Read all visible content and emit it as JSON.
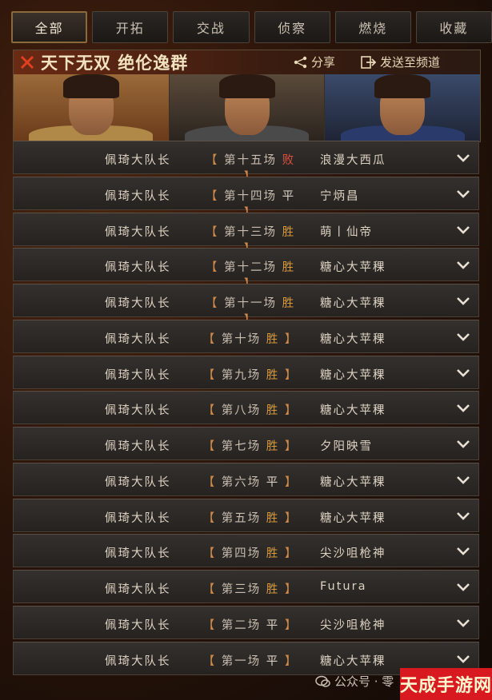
{
  "tabs": [
    {
      "label": "全部",
      "active": true
    },
    {
      "label": "开拓",
      "active": false
    },
    {
      "label": "交战",
      "active": false
    },
    {
      "label": "侦察",
      "active": false
    },
    {
      "label": "燃烧",
      "active": false
    },
    {
      "label": "收藏",
      "active": false
    }
  ],
  "banner": {
    "title": "天下无双 绝伦逸群",
    "share_label": "分享",
    "send_label": "发送至频道"
  },
  "rows": [
    {
      "player": "佩琦大队长",
      "match": "第十五场",
      "result": "败",
      "result_type": "lose",
      "opponent": "浪漫大西瓜"
    },
    {
      "player": "佩琦大队长",
      "match": "第十四场",
      "result": "平",
      "result_type": "draw",
      "opponent": "宁炳昌"
    },
    {
      "player": "佩琦大队长",
      "match": "第十三场",
      "result": "胜",
      "result_type": "win",
      "opponent": "萌丨仙帝"
    },
    {
      "player": "佩琦大队长",
      "match": "第十二场",
      "result": "胜",
      "result_type": "win",
      "opponent": "糖心大苹稞"
    },
    {
      "player": "佩琦大队长",
      "match": "第十一场",
      "result": "胜",
      "result_type": "win",
      "opponent": "糖心大苹稞"
    },
    {
      "player": "佩琦大队长",
      "match": "第十场",
      "result": "胜",
      "result_type": "win",
      "opponent": "糖心大苹稞"
    },
    {
      "player": "佩琦大队长",
      "match": "第九场",
      "result": "胜",
      "result_type": "win",
      "opponent": "糖心大苹稞"
    },
    {
      "player": "佩琦大队长",
      "match": "第八场",
      "result": "胜",
      "result_type": "win",
      "opponent": "糖心大苹稞"
    },
    {
      "player": "佩琦大队长",
      "match": "第七场",
      "result": "胜",
      "result_type": "win",
      "opponent": "夕阳映雪"
    },
    {
      "player": "佩琦大队长",
      "match": "第六场",
      "result": "平",
      "result_type": "draw",
      "opponent": "糖心大苹稞"
    },
    {
      "player": "佩琦大队长",
      "match": "第五场",
      "result": "胜",
      "result_type": "win",
      "opponent": "糖心大苹稞"
    },
    {
      "player": "佩琦大队长",
      "match": "第四场",
      "result": "胜",
      "result_type": "win",
      "opponent": "尖沙咀枪神"
    },
    {
      "player": "佩琦大队长",
      "match": "第三场",
      "result": "胜",
      "result_type": "win",
      "opponent": "Futura"
    },
    {
      "player": "佩琦大队长",
      "match": "第二场",
      "result": "平",
      "result_type": "draw",
      "opponent": "尖沙咀枪神"
    },
    {
      "player": "佩琦大队长",
      "match": "第一场",
      "result": "平",
      "result_type": "draw",
      "opponent": "糖心大苹稞"
    }
  ],
  "watermark": {
    "left_text": "公众号 · 零",
    "right_text": "天成手游网"
  },
  "colors": {
    "win": "#d89a3a",
    "lose": "#e05040",
    "draw": "#d8d0c4",
    "accent": "#8a6a3a"
  }
}
